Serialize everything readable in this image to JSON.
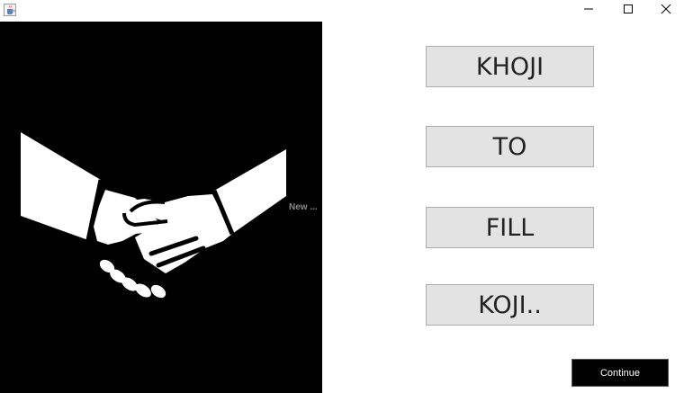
{
  "window": {
    "app_icon": "java-cup-icon",
    "controls": {
      "minimize_icon": "minimize-icon",
      "maximize_icon": "maximize-icon",
      "close_icon": "close-icon"
    }
  },
  "image_panel": {
    "icon": "handshake-icon",
    "background": "#000000",
    "foreground": "#ffffff"
  },
  "clipped_label": "New ...",
  "word_buttons": [
    {
      "label": "KHOJI"
    },
    {
      "label": "TO"
    },
    {
      "label": "FILL"
    },
    {
      "label": "KOJI.."
    }
  ],
  "continue_button": {
    "label": "Continue",
    "background": "#000000",
    "text_color": "#ffffff"
  }
}
